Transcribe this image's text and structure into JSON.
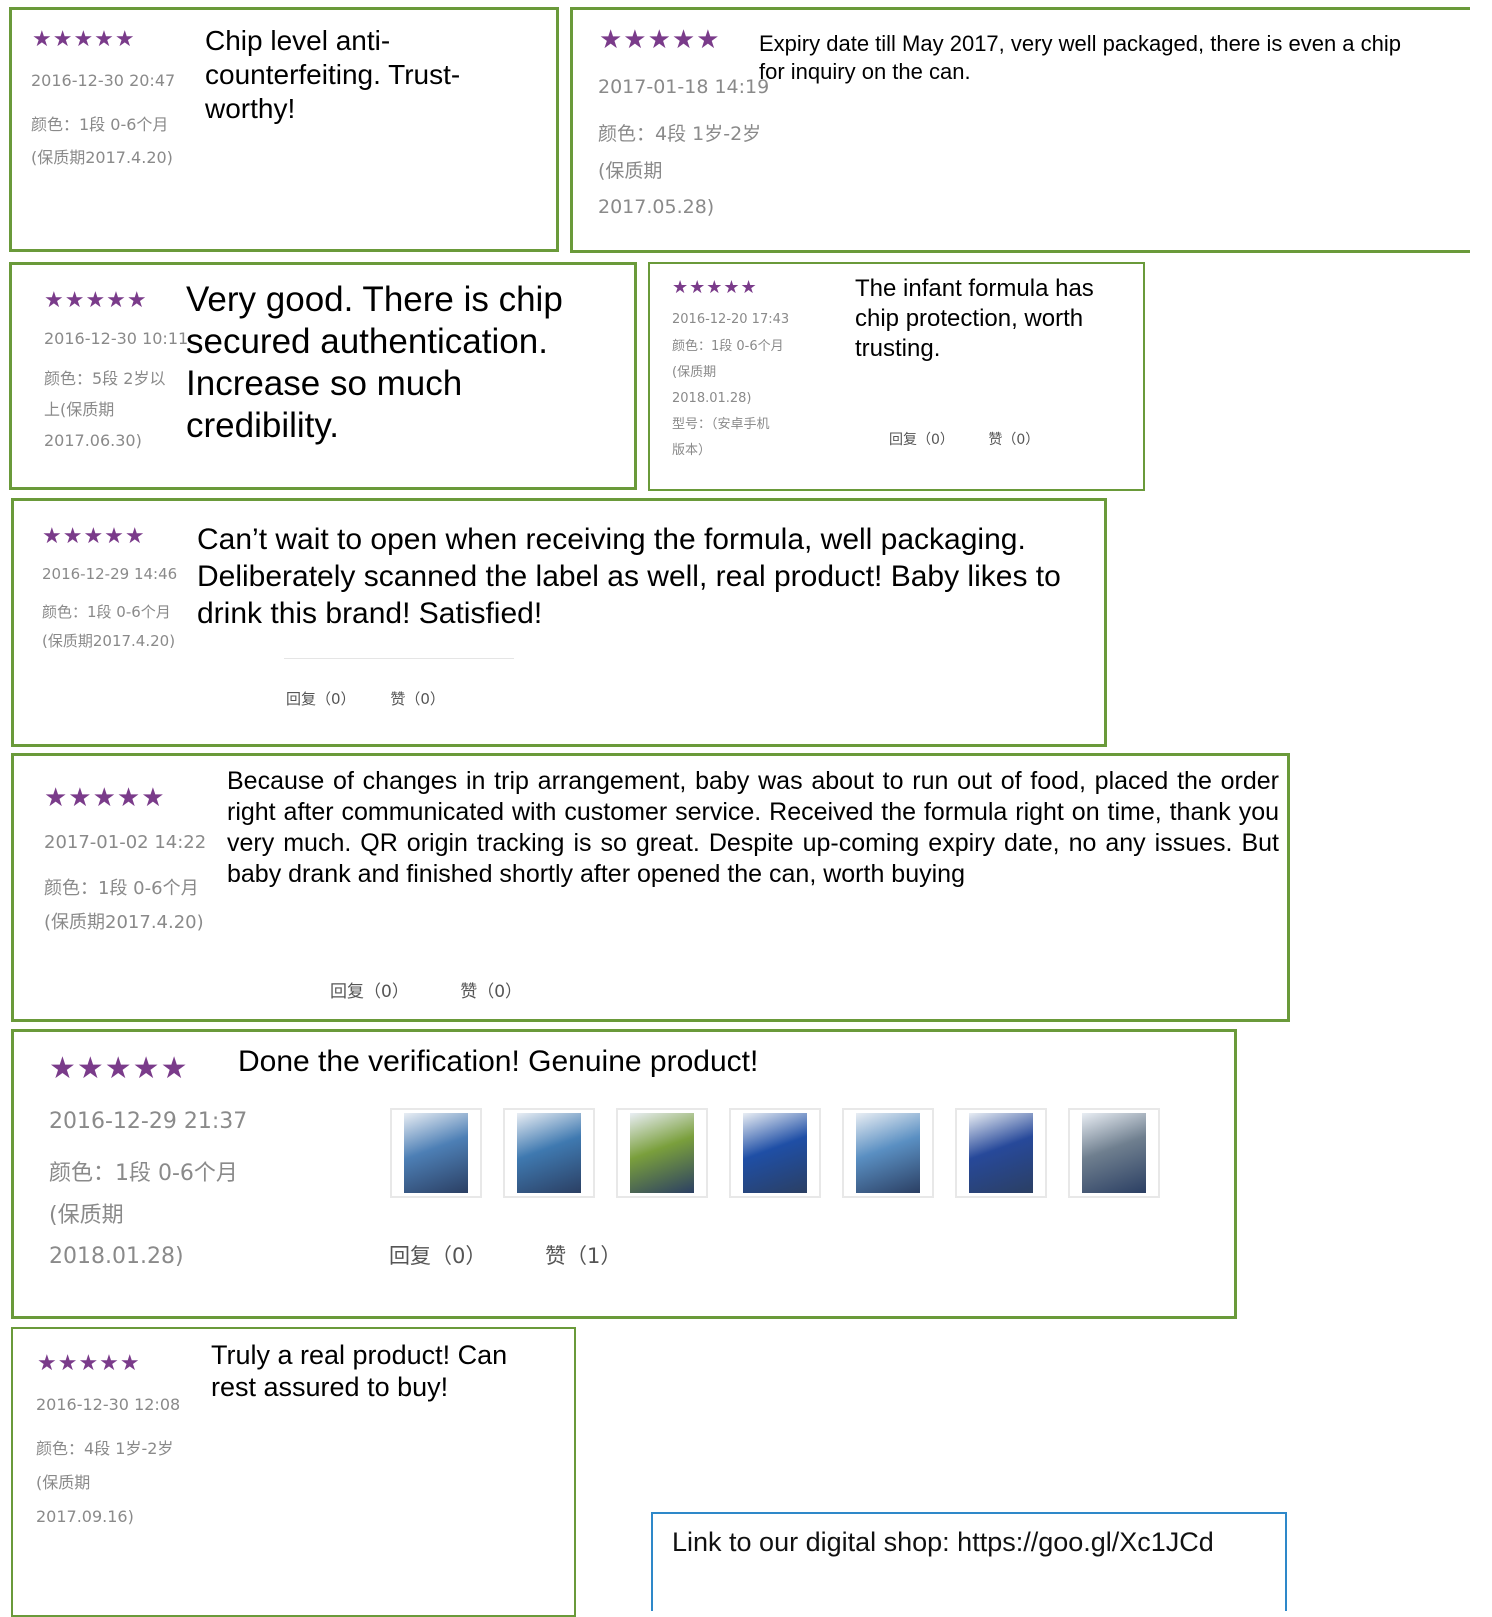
{
  "stars": "★★★★★",
  "reviews": [
    {
      "date": "2016-12-30 20:47",
      "variant": "颜色：1段 0-6个月",
      "expiry": [
        "(保质期2017.4.20)"
      ],
      "text": "Chip level anti-counterfeiting. Trust-worthy!"
    },
    {
      "date": "2017-01-18 14:19",
      "variant": "颜色：4段 1岁-2岁",
      "expiry": [
        "(保质期",
        "2017.05.28)"
      ],
      "text": "Expiry date till May 2017, very well packaged, there is even a chip for inquiry on the can."
    },
    {
      "date": "2016-12-30 10:11",
      "variant": "颜色：5段 2岁以",
      "expiry": [
        "上(保质期",
        "2017.06.30)"
      ],
      "text": "Very good. There is chip secured authentication. Increase so much credibility."
    },
    {
      "date": "2016-12-20 17:43",
      "variant": "颜色：1段 0-6个月",
      "expiry": [
        "(保质期",
        "2018.01.28)",
        "型号：（安卓手机",
        "版本）"
      ],
      "text": "The infant formula has chip protection, worth trusting.",
      "reply": "回复（0）",
      "like": "赞（0）"
    },
    {
      "date": "2016-12-29 14:46",
      "variant": "颜色：1段 0-6个月",
      "expiry": [
        "(保质期2017.4.20)"
      ],
      "text": "Can’t wait to open when receiving the formula, well packaging. Deliberately scanned the label as well, real product! Baby likes to drink this brand! Satisfied!",
      "reply": "回复（0）",
      "like": "赞（0）"
    },
    {
      "date": "2017-01-02 14:22",
      "variant": "颜色：1段 0-6个月",
      "expiry": [
        "(保质期2017.4.20)"
      ],
      "text": "Because of changes in trip arrangement, baby was about to run out of food, placed the order right after communicated with customer service. Received the formula right on time, thank you very much. QR origin tracking is so great. Despite up-coming expiry date, no any issues. But baby drank and finished shortly after opened the can, worth buying",
      "reply": "回复（0）",
      "like": "赞（0）"
    },
    {
      "date": "2016-12-29 21:37",
      "variant": "颜色：1段 0-6个月",
      "expiry": [
        "(保质期",
        "2018.01.28)"
      ],
      "text": "Done the verification! Genuine product!",
      "reply": "回复（0）",
      "like": "赞（1）"
    },
    {
      "date": "2016-12-30 12:08",
      "variant": "颜色：4段 1岁-2岁",
      "expiry": [
        "(保质期",
        "2017.09.16)"
      ],
      "text": "Truly a real product! Can rest assured to buy!"
    }
  ],
  "photos": [
    {
      "icon": "formula-can-photo",
      "color": "#4d7fb5"
    },
    {
      "icon": "formula-box-photo",
      "color": "#3f79b0"
    },
    {
      "icon": "formula-can-label-photo",
      "color": "#7a9f3c"
    },
    {
      "icon": "blue-scoop-photo",
      "color": "#1f4fa6"
    },
    {
      "icon": "barcode-photo",
      "color": "#5a8fc2"
    },
    {
      "icon": "blue-lid-photo",
      "color": "#27499a"
    },
    {
      "icon": "packaging-photo",
      "color": "#6f7f8f"
    }
  ],
  "shop_link": "Link to our digital shop: https://goo.gl/Xc1JCd",
  "colors": {
    "border": "#6a9a3a",
    "stars": "#7a3b8a",
    "meta": "#8a8a8a",
    "link_border": "#2e88c9"
  }
}
